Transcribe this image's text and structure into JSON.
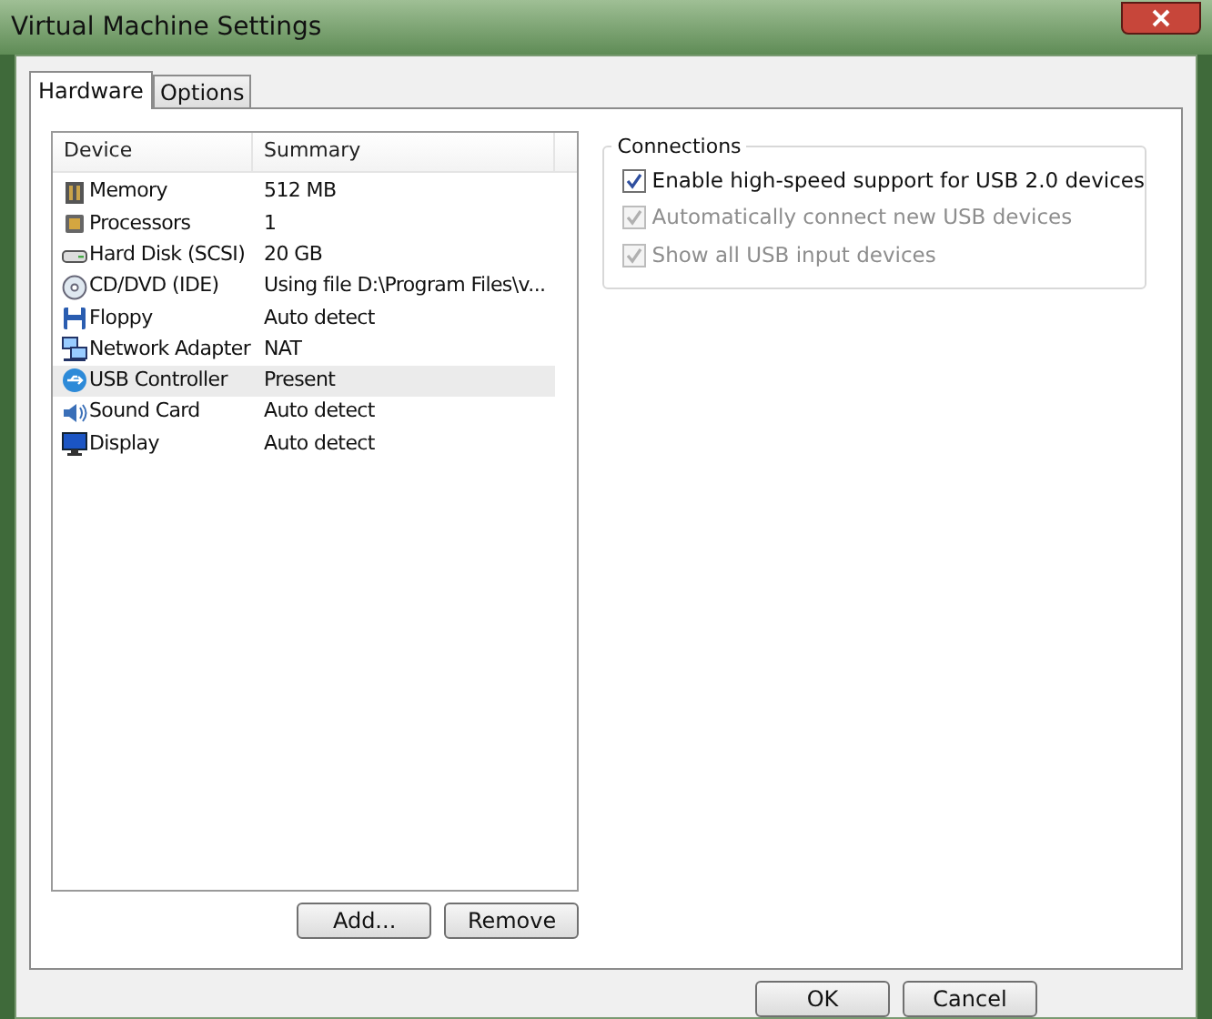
{
  "window": {
    "title": "Virtual Machine Settings"
  },
  "tabs": [
    {
      "label": "Hardware",
      "selected": true
    },
    {
      "label": "Options",
      "selected": false
    }
  ],
  "device_list": {
    "columns": [
      "Device",
      "Summary"
    ],
    "rows": [
      {
        "kind": "memory",
        "device": "Memory",
        "summary": "512 MB",
        "selected": false
      },
      {
        "kind": "processor",
        "device": "Processors",
        "summary": "1",
        "selected": false
      },
      {
        "kind": "disk",
        "device": "Hard Disk (SCSI)",
        "summary": "20 GB",
        "selected": false
      },
      {
        "kind": "cd",
        "device": "CD/DVD (IDE)",
        "summary": "Using file D:\\Program Files\\v...",
        "selected": false
      },
      {
        "kind": "floppy",
        "device": "Floppy",
        "summary": "Auto detect",
        "selected": false
      },
      {
        "kind": "network",
        "device": "Network Adapter",
        "summary": "NAT",
        "selected": false
      },
      {
        "kind": "usb",
        "device": "USB Controller",
        "summary": "Present",
        "selected": true
      },
      {
        "kind": "sound",
        "device": "Sound Card",
        "summary": "Auto detect",
        "selected": false
      },
      {
        "kind": "display",
        "device": "Display",
        "summary": "Auto detect",
        "selected": false
      }
    ]
  },
  "list_buttons": [
    "Add...",
    "Remove"
  ],
  "connections": {
    "title": "Connections",
    "options": [
      {
        "label": "Enable high-speed support for USB 2.0 devices",
        "checked": true,
        "disabled": false
      },
      {
        "label": "Automatically connect new USB devices",
        "checked": true,
        "disabled": true
      },
      {
        "label": "Show all USB input devices",
        "checked": true,
        "disabled": true
      }
    ]
  },
  "dialog_buttons": [
    "OK",
    "Cancel"
  ]
}
